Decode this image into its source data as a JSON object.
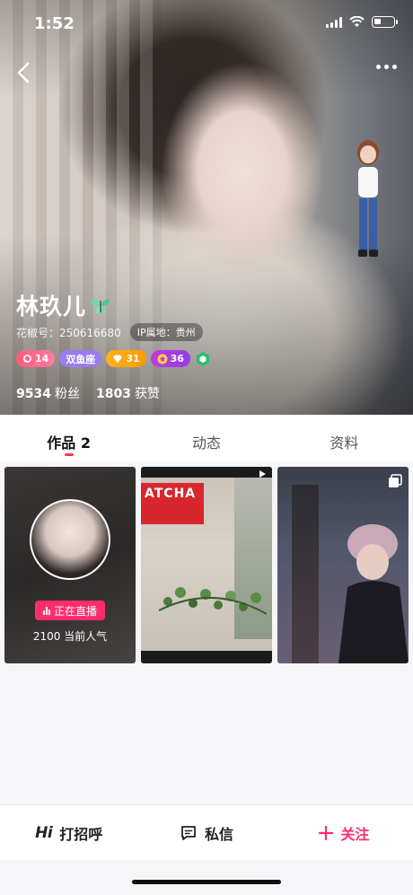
{
  "status_bar": {
    "time": "1:52"
  },
  "profile": {
    "name": "林玖儿",
    "id_label": "花椒号：250616680",
    "ip_label": "IP属地：贵州",
    "badges": [
      {
        "icon": "heart-ring-icon",
        "label": "14",
        "color": "#ff5d7a"
      },
      {
        "icon": "",
        "label": "双鱼座",
        "color": "#9a7cf0"
      },
      {
        "icon": "diamond-icon",
        "label": "31",
        "color": "#ffb21c"
      },
      {
        "icon": "star-icon",
        "label": "36",
        "color": "#b03be0"
      }
    ],
    "stats": [
      {
        "value": "9534",
        "label": "粉丝"
      },
      {
        "value": "1803",
        "label": "获赞"
      }
    ]
  },
  "tabs": [
    {
      "label": "作品 2",
      "active": true
    },
    {
      "label": "动态",
      "active": false
    },
    {
      "label": "资料",
      "active": false
    }
  ],
  "works": {
    "live_label": "正在直播",
    "popularity": "2100 当前人气",
    "sign_text": "ATCHA"
  },
  "actions": {
    "hi_mark": "Hi",
    "greet": "打招呼",
    "message": "私信",
    "follow": "关注"
  },
  "colors": {
    "accent": "#ff2d6f",
    "tab_indicator": "#ff3b5c"
  }
}
